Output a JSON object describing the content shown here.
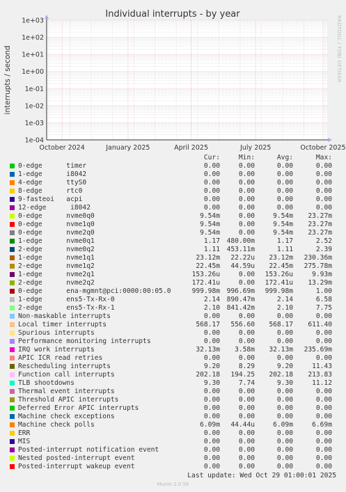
{
  "chart_data": {
    "type": "line",
    "title": "Individual interrupts - by year",
    "ylabel": "interrupts / second",
    "yscale": "log",
    "ylim": [
      0.0001,
      1000
    ],
    "y_ticks": [
      "1e+03",
      "1e+02",
      "1e+01",
      "1e+00",
      "1e-01",
      "1e-02",
      "1e-03",
      "1e-04"
    ],
    "x_ticks": [
      "October 2024",
      "January 2025",
      "April 2025",
      "July 2025",
      "October 2025"
    ],
    "side_label": "RRDTOOL / TOBI OETIKER",
    "series": []
  },
  "legend": {
    "headers": {
      "cur": "Cur:",
      "min": "Min:",
      "avg": "Avg:",
      "max": "Max:"
    },
    "rows": [
      {
        "name": "0-edge      timer",
        "color": "#00cc00",
        "cur": "0.00",
        "min": "0.00",
        "avg": "0.00",
        "max": "0.00"
      },
      {
        "name": "1-edge      i8042",
        "color": "#0066b3",
        "cur": "0.00",
        "min": "0.00",
        "avg": "0.00",
        "max": "0.00"
      },
      {
        "name": "4-edge      ttyS0",
        "color": "#ff8000",
        "cur": "0.00",
        "min": "0.00",
        "avg": "0.00",
        "max": "0.00"
      },
      {
        "name": "8-edge      rtc0",
        "color": "#ffcc00",
        "cur": "0.00",
        "min": "0.00",
        "avg": "0.00",
        "max": "0.00"
      },
      {
        "name": "9-fasteoi   acpi",
        "color": "#330099",
        "cur": "0.00",
        "min": "0.00",
        "avg": "0.00",
        "max": "0.00"
      },
      {
        "name": "12-edge      i8042",
        "color": "#990099",
        "cur": "0.00",
        "min": "0.00",
        "avg": "0.00",
        "max": "0.00"
      },
      {
        "name": "0-edge      nvme0q0",
        "color": "#ccff00",
        "cur": "9.54m",
        "min": "0.00",
        "avg": "9.54m",
        "max": "23.27m"
      },
      {
        "name": "0-edge      nvme1q0",
        "color": "#ff0000",
        "cur": "9.54m",
        "min": "0.00",
        "avg": "9.54m",
        "max": "23.27m"
      },
      {
        "name": "0-edge      nvme2q0",
        "color": "#808080",
        "cur": "9.54m",
        "min": "0.00",
        "avg": "9.54m",
        "max": "23.27m"
      },
      {
        "name": "1-edge      nvme0q1",
        "color": "#008f00",
        "cur": "1.17",
        "min": "480.00m",
        "avg": "1.17",
        "max": "2.52"
      },
      {
        "name": "2-edge      nvme0q2",
        "color": "#00487d",
        "cur": "1.11",
        "min": "453.11m",
        "avg": "1.11",
        "max": "2.39"
      },
      {
        "name": "1-edge      nvme1q1",
        "color": "#b35a00",
        "cur": "23.12m",
        "min": "22.22u",
        "avg": "23.12m",
        "max": "230.36m"
      },
      {
        "name": "2-edge      nvme1q2",
        "color": "#b38f00",
        "cur": "22.45m",
        "min": "44.59u",
        "avg": "22.45m",
        "max": "275.78m"
      },
      {
        "name": "1-edge      nvme2q1",
        "color": "#6b006b",
        "cur": "153.26u",
        "min": "0.00",
        "avg": "153.26u",
        "max": "9.93m"
      },
      {
        "name": "2-edge      nvme2q2",
        "color": "#8fb300",
        "cur": "172.41u",
        "min": "0.00",
        "avg": "172.41u",
        "max": "13.29m"
      },
      {
        "name": "0-edge      ena-mgmnt@pci:0000:00:05.0",
        "color": "#b30000",
        "cur": "999.98m",
        "min": "996.69m",
        "avg": "999.98m",
        "max": "1.00"
      },
      {
        "name": "1-edge      ens5-Tx-Rx-0",
        "color": "#bebebe",
        "cur": "2.14",
        "min": "890.47m",
        "avg": "2.14",
        "max": "6.58"
      },
      {
        "name": "2-edge      ens5-Tx-Rx-1",
        "color": "#80ff80",
        "cur": "2.10",
        "min": "841.42m",
        "avg": "2.10",
        "max": "7.75"
      },
      {
        "name": "Non-maskable interrupts",
        "color": "#80c9ff",
        "cur": "0.00",
        "min": "0.00",
        "avg": "0.00",
        "max": "0.00"
      },
      {
        "name": "Local timer interrupts",
        "color": "#ffc080",
        "cur": "568.17",
        "min": "556.60",
        "avg": "568.17",
        "max": "611.40"
      },
      {
        "name": "Spurious interrupts",
        "color": "#ffe680",
        "cur": "0.00",
        "min": "0.00",
        "avg": "0.00",
        "max": "0.00"
      },
      {
        "name": "Performance monitoring interrupts",
        "color": "#aa80ff",
        "cur": "0.00",
        "min": "0.00",
        "avg": "0.00",
        "max": "0.00"
      },
      {
        "name": "IRQ work interrupts",
        "color": "#ee00cc",
        "cur": "32.13m",
        "min": "3.58m",
        "avg": "32.13m",
        "max": "235.69m"
      },
      {
        "name": "APIC ICR read retries",
        "color": "#ff8080",
        "cur": "0.00",
        "min": "0.00",
        "avg": "0.00",
        "max": "0.00"
      },
      {
        "name": "Rescheduling interrupts",
        "color": "#666600",
        "cur": "9.20",
        "min": "8.29",
        "avg": "9.20",
        "max": "11.43"
      },
      {
        "name": "Function call interrupts",
        "color": "#ffbfff",
        "cur": "202.18",
        "min": "194.25",
        "avg": "202.18",
        "max": "213.83"
      },
      {
        "name": "TLB shootdowns",
        "color": "#00ffcc",
        "cur": "9.30",
        "min": "7.74",
        "avg": "9.30",
        "max": "11.12"
      },
      {
        "name": "Thermal event interrupts",
        "color": "#cc6699",
        "cur": "0.00",
        "min": "0.00",
        "avg": "0.00",
        "max": "0.00"
      },
      {
        "name": "Threshold APIC interrupts",
        "color": "#999900",
        "cur": "0.00",
        "min": "0.00",
        "avg": "0.00",
        "max": "0.00"
      },
      {
        "name": "Deferred Error APIC interrupts",
        "color": "#00cc00",
        "cur": "0.00",
        "min": "0.00",
        "avg": "0.00",
        "max": "0.00"
      },
      {
        "name": "Machine check exceptions",
        "color": "#0066b3",
        "cur": "0.00",
        "min": "0.00",
        "avg": "0.00",
        "max": "0.00"
      },
      {
        "name": "Machine check polls",
        "color": "#ff8000",
        "cur": "6.09m",
        "min": "44.44u",
        "avg": "6.09m",
        "max": "6.69m"
      },
      {
        "name": "ERR",
        "color": "#ffcc00",
        "cur": "0.00",
        "min": "0.00",
        "avg": "0.00",
        "max": "0.00"
      },
      {
        "name": "MIS",
        "color": "#330099",
        "cur": "0.00",
        "min": "0.00",
        "avg": "0.00",
        "max": "0.00"
      },
      {
        "name": "Posted-interrupt notification event",
        "color": "#990099",
        "cur": "0.00",
        "min": "0.00",
        "avg": "0.00",
        "max": "0.00"
      },
      {
        "name": "Nested posted-interrupt event",
        "color": "#ccff00",
        "cur": "0.00",
        "min": "0.00",
        "avg": "0.00",
        "max": "0.00"
      },
      {
        "name": "Posted-interrupt wakeup event",
        "color": "#ff0000",
        "cur": "0.00",
        "min": "0.00",
        "avg": "0.00",
        "max": "0.00"
      }
    ]
  },
  "last_update": "Last update: Wed Oct 29 01:00:01 2025",
  "footer": "Munin 2.0.56"
}
